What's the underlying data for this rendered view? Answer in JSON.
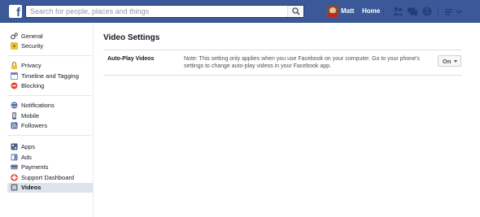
{
  "topbar": {
    "logo": "f",
    "search_placeholder": "Search for people, places and things",
    "user_name": "Matt",
    "home_label": "Home",
    "brand_color": "#3b5998",
    "icons": [
      "friend-requests-icon",
      "messages-icon",
      "notifications-icon",
      "account-menu-icon"
    ]
  },
  "sidebar": {
    "groups": [
      [
        {
          "label": "General",
          "icon": "gears-icon"
        },
        {
          "label": "Security",
          "icon": "lock-icon"
        }
      ],
      [
        {
          "label": "Privacy",
          "icon": "privacy-padlock-icon"
        },
        {
          "label": "Timeline and Tagging",
          "icon": "timeline-icon"
        },
        {
          "label": "Blocking",
          "icon": "block-icon"
        }
      ],
      [
        {
          "label": "Notifications",
          "icon": "globe-icon"
        },
        {
          "label": "Mobile",
          "icon": "phone-icon"
        },
        {
          "label": "Followers",
          "icon": "rss-icon"
        }
      ],
      [
        {
          "label": "Apps",
          "icon": "apps-icon"
        },
        {
          "label": "Ads",
          "icon": "ads-icon"
        },
        {
          "label": "Payments",
          "icon": "card-icon"
        },
        {
          "label": "Support Dashboard",
          "icon": "lifebuoy-icon"
        },
        {
          "label": "Videos",
          "icon": "film-icon",
          "active": true
        }
      ]
    ]
  },
  "main": {
    "title": "Video Settings",
    "setting": {
      "label": "Auto-Play Videos",
      "note": "Note: This setting only applies when you use Facebook on your computer. Go to your phone's settings to change auto-play videos in your Facebook app.",
      "value": "On"
    }
  }
}
